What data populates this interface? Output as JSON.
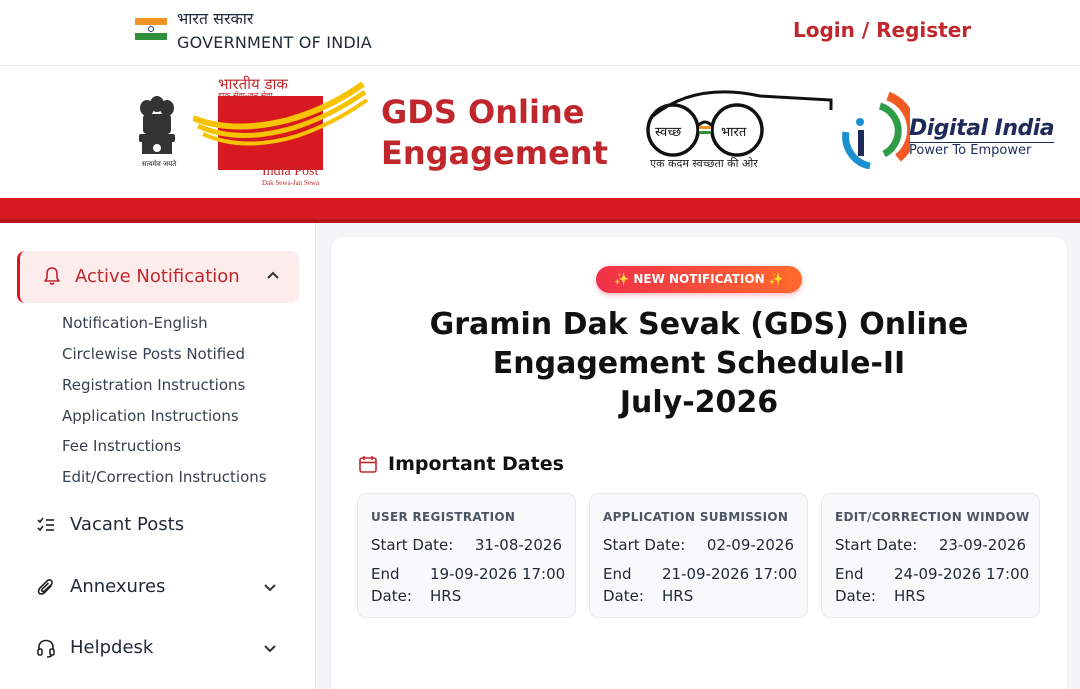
{
  "gov": {
    "hindi": "भारत सरकार",
    "english": "GOVERNMENT OF INDIA",
    "login": "Login / Register"
  },
  "header": {
    "emblem_caption": "सत्यमेव जयते",
    "indiapost_hindi": "भारतीय डाक",
    "indiapost_hindi_sub": "डाक सेवा-जन सेवा",
    "indiapost_name": "India Post",
    "indiapost_tagline": "Dak Sewa-Jan Sewa",
    "title": "GDS Online Engagement",
    "swachh_left": "स्वच्छ",
    "swachh_right": "भारत",
    "swachh_caption": "एक कदम स्वच्छता की ओर",
    "digital_india": "Digital India",
    "digital_india_sub": "Power To Empower"
  },
  "sidebar": {
    "active": "Active Notification",
    "sub_items": [
      "Notification-English",
      "Circlewise Posts Notified",
      "Registration Instructions",
      "Application Instructions",
      "Fee Instructions",
      "Edit/Correction Instructions"
    ],
    "items": [
      {
        "label": "Vacant Posts",
        "icon": "checklist-icon"
      },
      {
        "label": "Annexures",
        "icon": "paperclip-icon"
      },
      {
        "label": "Helpdesk",
        "icon": "headset-icon"
      }
    ]
  },
  "main": {
    "badge": "✨ NEW NOTIFICATION ✨",
    "title_line1": "Gramin Dak Sevak (GDS) Online",
    "title_line2": "Engagement Schedule-II",
    "title_line3": "July-2026",
    "dates_heading": "Important Dates",
    "dates": [
      {
        "title": "USER REGISTRATION",
        "start_label": "Start Date:",
        "start": "31-08-2026",
        "end_label": "End Date:",
        "end": "19-09-2026 17:00 HRS"
      },
      {
        "title": "APPLICATION SUBMISSION",
        "start_label": "Start Date:",
        "start": "02-09-2026",
        "end_label": "End Date:",
        "end": "21-09-2026 17:00 HRS"
      },
      {
        "title": "EDIT/CORRECTION WINDOW",
        "start_label": "Start Date:",
        "start": "23-09-2026",
        "end_label": "End Date:",
        "end": "24-09-2026 17:00 HRS"
      }
    ]
  },
  "colors": {
    "brand_red": "#c0272d",
    "bar_red": "#d71921",
    "di_navy": "#1f2a58"
  }
}
